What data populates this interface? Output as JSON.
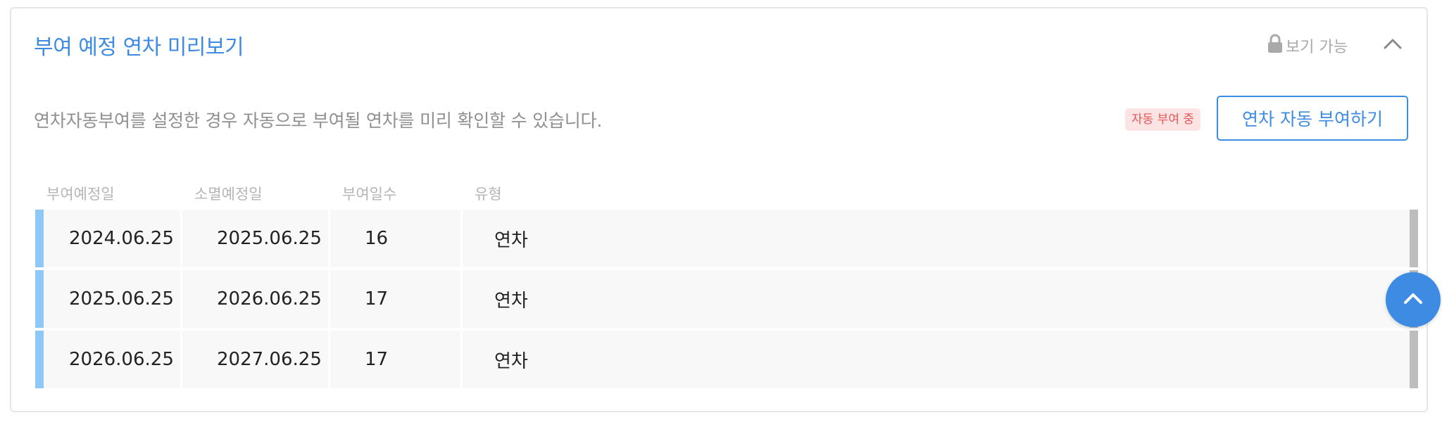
{
  "section": {
    "title": "부여 예정 연차 미리보기",
    "view_permission": "보기 가능",
    "description": "연차자동부여를 설정한 경우 자동으로 부여될 연차를 미리 확인할 수 있습니다.",
    "auto_status_badge": "자동 부여 중",
    "auto_grant_button": "연차 자동 부여하기"
  },
  "table": {
    "columns": [
      "부여예정일",
      "소멸예정일",
      "부여일수",
      "유형"
    ],
    "rows": [
      {
        "grant_date": "2024.06.25",
        "expire_date": "2025.06.25",
        "days": "16",
        "type": "연차"
      },
      {
        "grant_date": "2025.06.25",
        "expire_date": "2026.06.25",
        "days": "17",
        "type": "연차"
      },
      {
        "grant_date": "2026.06.25",
        "expire_date": "2027.06.25",
        "days": "17",
        "type": "연차"
      }
    ]
  },
  "colors": {
    "accent": "#3d8be2",
    "badge_bg": "#fde4e4",
    "badge_text": "#e25757",
    "row_accent_left": "#8ec8f6",
    "row_accent_right": "#bdbdbd"
  },
  "icons": {
    "lock": "lock-icon",
    "collapse": "chevron-up-icon",
    "scroll_top": "chevron-up-icon"
  }
}
